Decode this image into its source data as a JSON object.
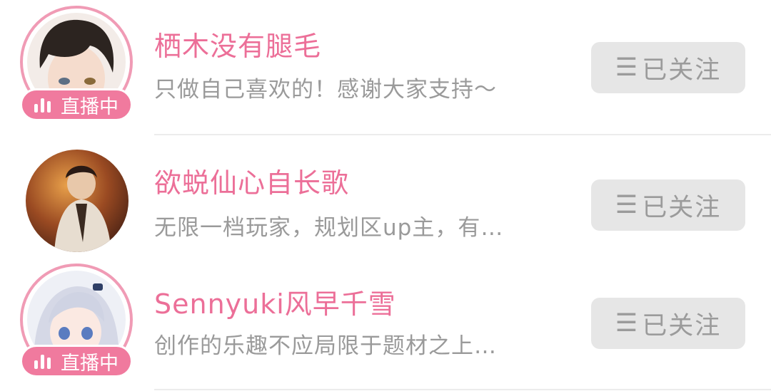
{
  "follow_list": {
    "items": [
      {
        "name": "栖木没有腿毛",
        "signature": "只做自己喜欢的！感谢大家支持～",
        "live": true,
        "live_label": "直播中",
        "follow_label": "已关注",
        "follow_icon": "☰"
      },
      {
        "name": "欲蜕仙心自长歌",
        "signature": "无限一档玩家，规划区up主，有…",
        "live": false,
        "follow_label": "已关注",
        "follow_icon": "☰"
      },
      {
        "name": "Sennyuki风早千雪",
        "signature": "创作的乐趣不应局限于题材之上…",
        "live": true,
        "live_label": "直播中",
        "follow_label": "已关注",
        "follow_icon": "☰"
      }
    ]
  },
  "colors": {
    "name_pink": "#ec6f98",
    "badge_pink": "#f07a9e",
    "ring_pink": "#f09bb5",
    "button_bg": "#e6e6e6",
    "muted_text": "#9a9a9a"
  }
}
